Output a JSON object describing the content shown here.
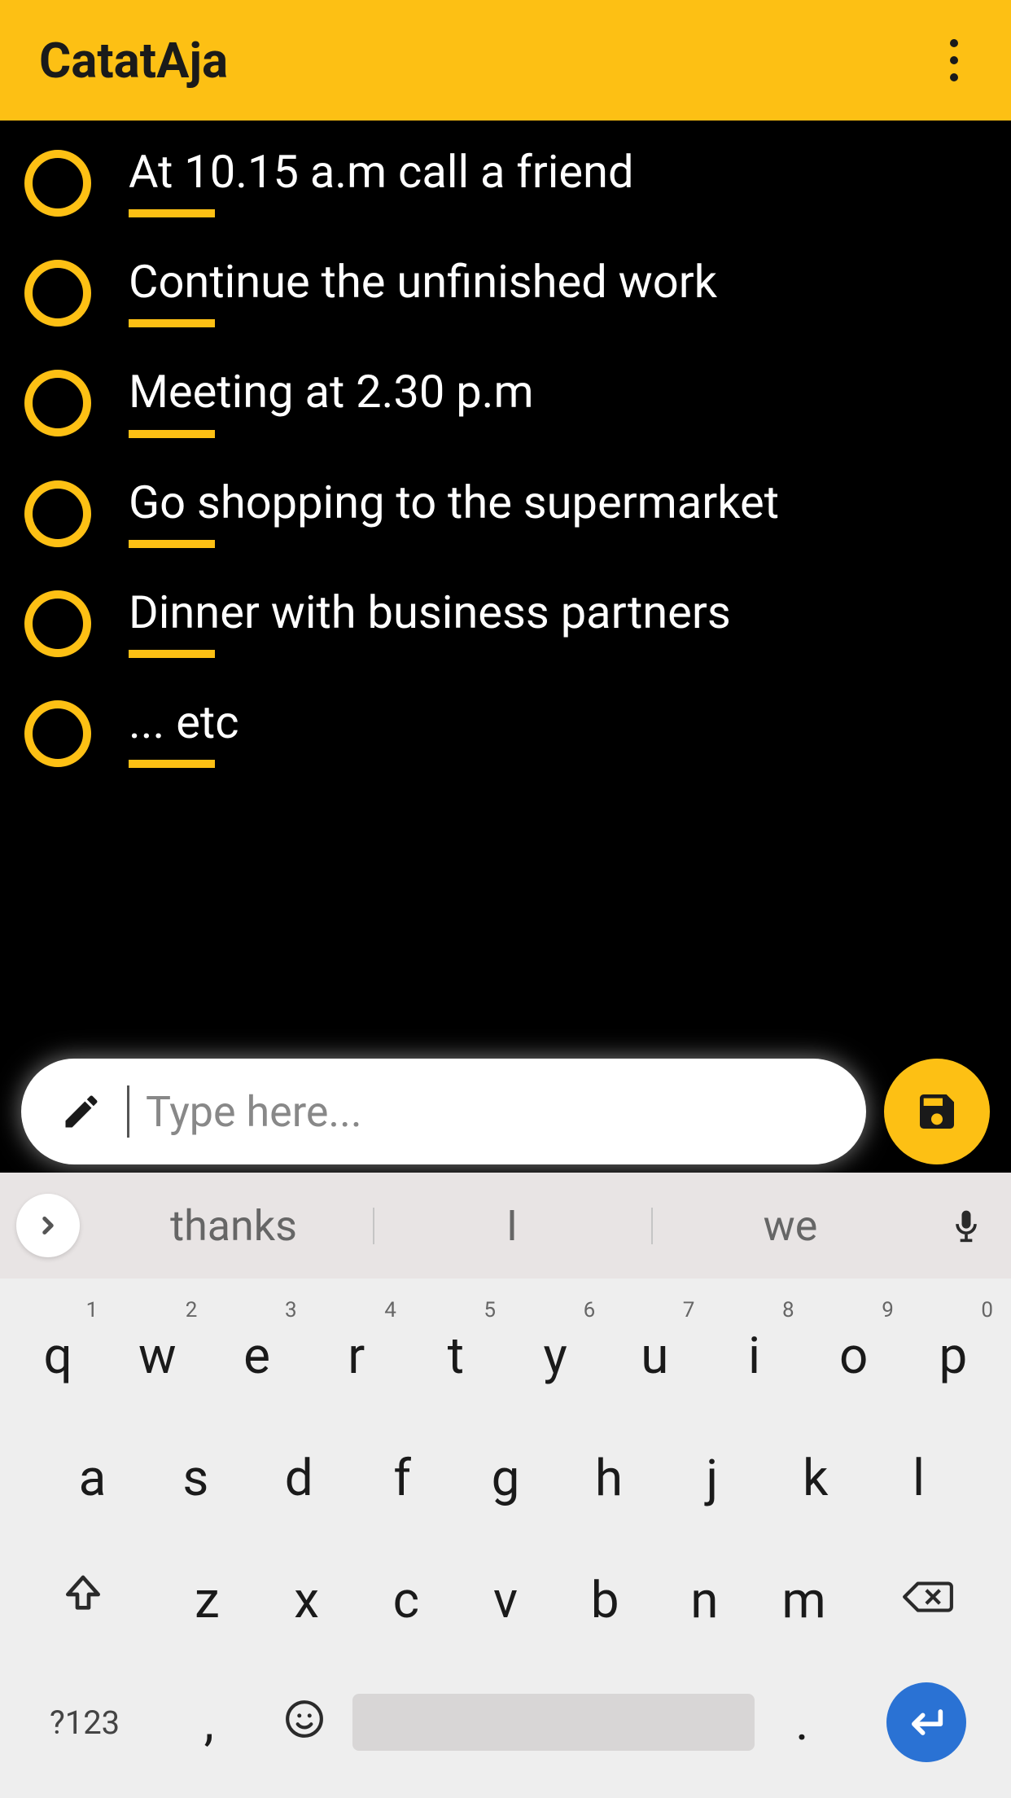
{
  "header": {
    "title": "CatatAja"
  },
  "tasks": [
    {
      "text": "At 10.15 a.m call a friend"
    },
    {
      "text": "Continue the unfinished work"
    },
    {
      "text": "Meeting at 2.30 p.m"
    },
    {
      "text": "Go shopping to the supermarket"
    },
    {
      "text": "Dinner with business partners"
    },
    {
      "text": "... etc"
    }
  ],
  "input": {
    "placeholder": "Type here...",
    "value": ""
  },
  "keyboard": {
    "suggestions": [
      "thanks",
      "I",
      "we"
    ],
    "row1": [
      {
        "k": "q",
        "s": "1"
      },
      {
        "k": "w",
        "s": "2"
      },
      {
        "k": "e",
        "s": "3"
      },
      {
        "k": "r",
        "s": "4"
      },
      {
        "k": "t",
        "s": "5"
      },
      {
        "k": "y",
        "s": "6"
      },
      {
        "k": "u",
        "s": "7"
      },
      {
        "k": "i",
        "s": "8"
      },
      {
        "k": "o",
        "s": "9"
      },
      {
        "k": "p",
        "s": "0"
      }
    ],
    "row2": [
      "a",
      "s",
      "d",
      "f",
      "g",
      "h",
      "j",
      "k",
      "l"
    ],
    "row3": [
      "z",
      "x",
      "c",
      "v",
      "b",
      "n",
      "m"
    ],
    "sym": "?123",
    "comma": ",",
    "period": "."
  }
}
